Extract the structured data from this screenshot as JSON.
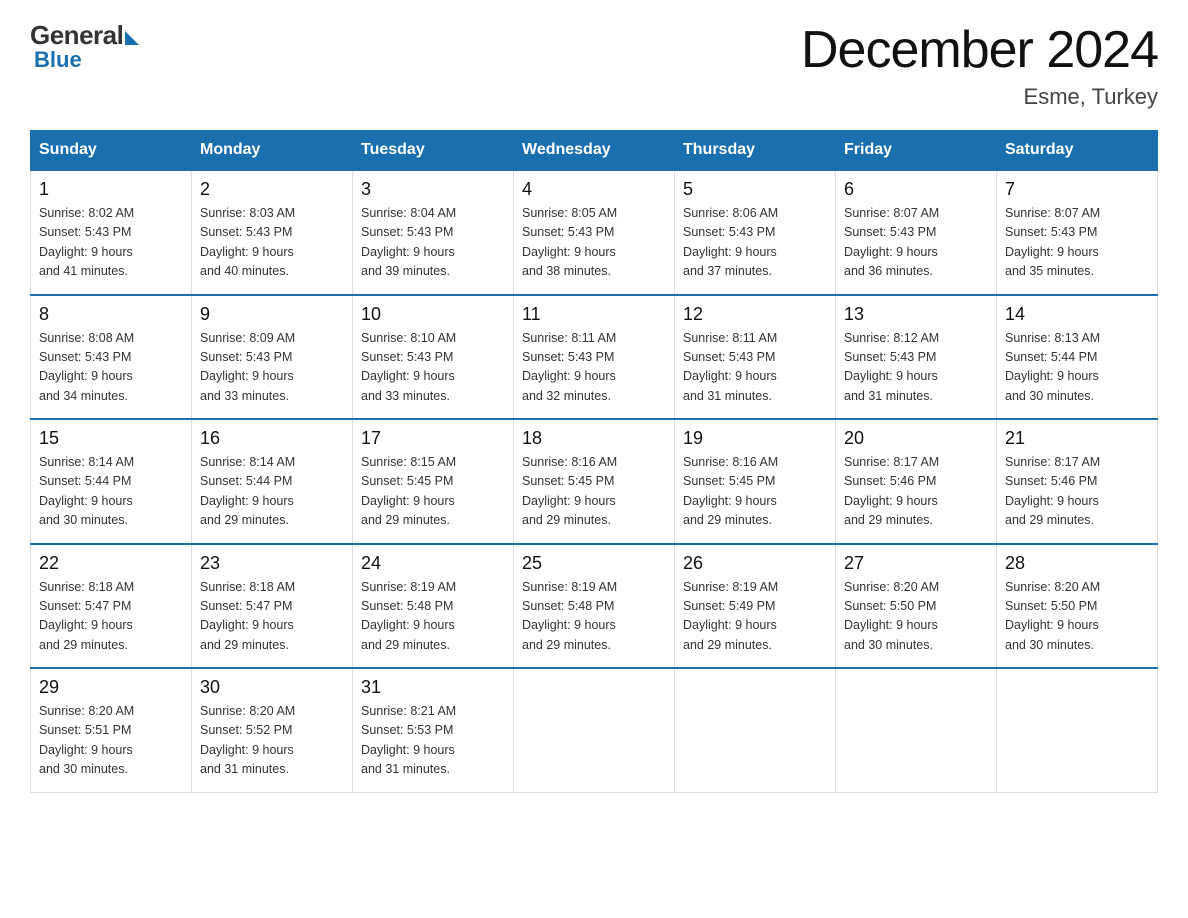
{
  "logo": {
    "general": "General",
    "blue": "Blue"
  },
  "header": {
    "title": "December 2024",
    "subtitle": "Esme, Turkey"
  },
  "days_of_week": [
    "Sunday",
    "Monday",
    "Tuesday",
    "Wednesday",
    "Thursday",
    "Friday",
    "Saturday"
  ],
  "weeks": [
    [
      {
        "date": "1",
        "sunrise": "8:02 AM",
        "sunset": "5:43 PM",
        "daylight": "9 hours and 41 minutes."
      },
      {
        "date": "2",
        "sunrise": "8:03 AM",
        "sunset": "5:43 PM",
        "daylight": "9 hours and 40 minutes."
      },
      {
        "date": "3",
        "sunrise": "8:04 AM",
        "sunset": "5:43 PM",
        "daylight": "9 hours and 39 minutes."
      },
      {
        "date": "4",
        "sunrise": "8:05 AM",
        "sunset": "5:43 PM",
        "daylight": "9 hours and 38 minutes."
      },
      {
        "date": "5",
        "sunrise": "8:06 AM",
        "sunset": "5:43 PM",
        "daylight": "9 hours and 37 minutes."
      },
      {
        "date": "6",
        "sunrise": "8:07 AM",
        "sunset": "5:43 PM",
        "daylight": "9 hours and 36 minutes."
      },
      {
        "date": "7",
        "sunrise": "8:07 AM",
        "sunset": "5:43 PM",
        "daylight": "9 hours and 35 minutes."
      }
    ],
    [
      {
        "date": "8",
        "sunrise": "8:08 AM",
        "sunset": "5:43 PM",
        "daylight": "9 hours and 34 minutes."
      },
      {
        "date": "9",
        "sunrise": "8:09 AM",
        "sunset": "5:43 PM",
        "daylight": "9 hours and 33 minutes."
      },
      {
        "date": "10",
        "sunrise": "8:10 AM",
        "sunset": "5:43 PM",
        "daylight": "9 hours and 33 minutes."
      },
      {
        "date": "11",
        "sunrise": "8:11 AM",
        "sunset": "5:43 PM",
        "daylight": "9 hours and 32 minutes."
      },
      {
        "date": "12",
        "sunrise": "8:11 AM",
        "sunset": "5:43 PM",
        "daylight": "9 hours and 31 minutes."
      },
      {
        "date": "13",
        "sunrise": "8:12 AM",
        "sunset": "5:43 PM",
        "daylight": "9 hours and 31 minutes."
      },
      {
        "date": "14",
        "sunrise": "8:13 AM",
        "sunset": "5:44 PM",
        "daylight": "9 hours and 30 minutes."
      }
    ],
    [
      {
        "date": "15",
        "sunrise": "8:14 AM",
        "sunset": "5:44 PM",
        "daylight": "9 hours and 30 minutes."
      },
      {
        "date": "16",
        "sunrise": "8:14 AM",
        "sunset": "5:44 PM",
        "daylight": "9 hours and 29 minutes."
      },
      {
        "date": "17",
        "sunrise": "8:15 AM",
        "sunset": "5:45 PM",
        "daylight": "9 hours and 29 minutes."
      },
      {
        "date": "18",
        "sunrise": "8:16 AM",
        "sunset": "5:45 PM",
        "daylight": "9 hours and 29 minutes."
      },
      {
        "date": "19",
        "sunrise": "8:16 AM",
        "sunset": "5:45 PM",
        "daylight": "9 hours and 29 minutes."
      },
      {
        "date": "20",
        "sunrise": "8:17 AM",
        "sunset": "5:46 PM",
        "daylight": "9 hours and 29 minutes."
      },
      {
        "date": "21",
        "sunrise": "8:17 AM",
        "sunset": "5:46 PM",
        "daylight": "9 hours and 29 minutes."
      }
    ],
    [
      {
        "date": "22",
        "sunrise": "8:18 AM",
        "sunset": "5:47 PM",
        "daylight": "9 hours and 29 minutes."
      },
      {
        "date": "23",
        "sunrise": "8:18 AM",
        "sunset": "5:47 PM",
        "daylight": "9 hours and 29 minutes."
      },
      {
        "date": "24",
        "sunrise": "8:19 AM",
        "sunset": "5:48 PM",
        "daylight": "9 hours and 29 minutes."
      },
      {
        "date": "25",
        "sunrise": "8:19 AM",
        "sunset": "5:48 PM",
        "daylight": "9 hours and 29 minutes."
      },
      {
        "date": "26",
        "sunrise": "8:19 AM",
        "sunset": "5:49 PM",
        "daylight": "9 hours and 29 minutes."
      },
      {
        "date": "27",
        "sunrise": "8:20 AM",
        "sunset": "5:50 PM",
        "daylight": "9 hours and 30 minutes."
      },
      {
        "date": "28",
        "sunrise": "8:20 AM",
        "sunset": "5:50 PM",
        "daylight": "9 hours and 30 minutes."
      }
    ],
    [
      {
        "date": "29",
        "sunrise": "8:20 AM",
        "sunset": "5:51 PM",
        "daylight": "9 hours and 30 minutes."
      },
      {
        "date": "30",
        "sunrise": "8:20 AM",
        "sunset": "5:52 PM",
        "daylight": "9 hours and 31 minutes."
      },
      {
        "date": "31",
        "sunrise": "8:21 AM",
        "sunset": "5:53 PM",
        "daylight": "9 hours and 31 minutes."
      },
      null,
      null,
      null,
      null
    ]
  ],
  "labels": {
    "sunrise": "Sunrise:",
    "sunset": "Sunset:",
    "daylight": "Daylight:"
  }
}
